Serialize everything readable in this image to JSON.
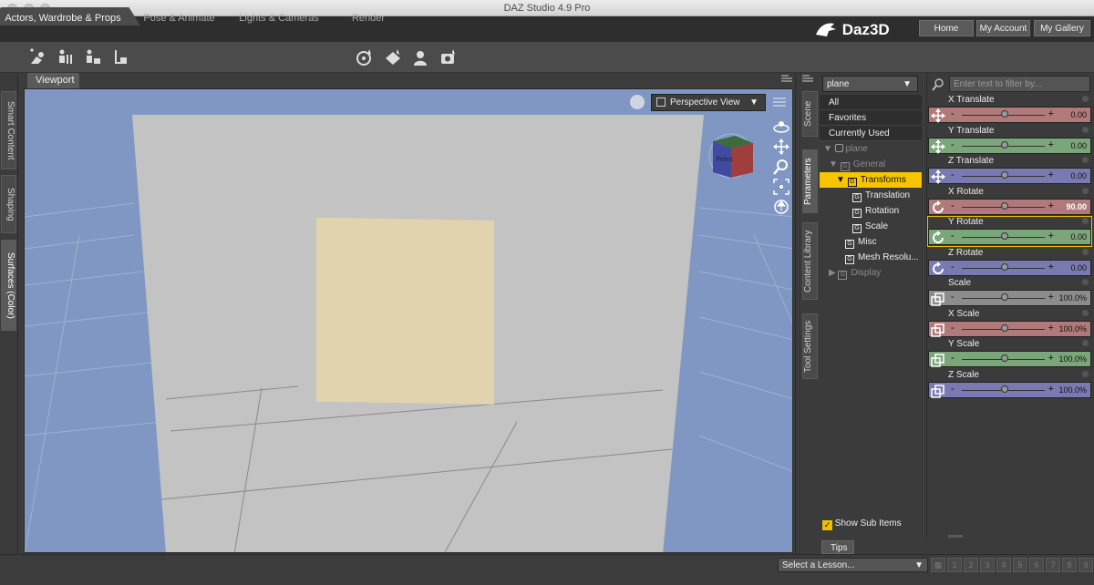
{
  "window": {
    "title": "DAZ Studio 4.9 Pro"
  },
  "tabs": [
    "Actors, Wardrobe & Props",
    "Pose & Animate",
    "Lights & Cameras",
    "Render"
  ],
  "brand": {
    "logo_text": "Daz3D"
  },
  "top_buttons": [
    "Home",
    "My Account",
    "My Gallery"
  ],
  "left_tabs": [
    "Smart Content",
    "Shaping",
    "Surfaces (Color)"
  ],
  "viewport": {
    "tab_label": "Viewport",
    "view_mode": "Perspective View",
    "cube_label": "Front"
  },
  "right_tabs": [
    "Scene",
    "Parameters",
    "Content Library",
    "Tool Settings"
  ],
  "tree": {
    "node_selector": "plane",
    "filters": [
      "All",
      "Favorites",
      "Currently Used"
    ],
    "items": [
      {
        "label": "plane"
      },
      {
        "label": "General"
      },
      {
        "label": "Transforms"
      },
      {
        "label": "Translation"
      },
      {
        "label": "Rotation"
      },
      {
        "label": "Scale"
      },
      {
        "label": "Misc"
      },
      {
        "label": "Mesh Resolu..."
      },
      {
        "label": "Display"
      }
    ],
    "show_sub_items": "Show Sub Items"
  },
  "filter": {
    "placeholder": "Enter text to filter by..."
  },
  "colors": {
    "x_axis": "#b07a7a",
    "y_axis": "#7aa67a",
    "z_axis": "#7a7ab2",
    "neutral": "#8c8c8c",
    "selection": "#f7c500"
  },
  "sliders": [
    {
      "label": "X Translate",
      "value": "0.00",
      "level": 0.5
    },
    {
      "label": "Y Translate",
      "value": "0.00",
      "level": 0.5
    },
    {
      "label": "Z Translate",
      "value": "0.00",
      "level": 0.5
    },
    {
      "label": "X Rotate",
      "value": "90.00",
      "level": 0.5
    },
    {
      "label": "Y Rotate",
      "value": "0.00",
      "level": 0.5
    },
    {
      "label": "Z Rotate",
      "value": "0.00",
      "level": 0.5
    },
    {
      "label": "Scale",
      "value": "100.0%",
      "level": 0.5
    },
    {
      "label": "X Scale",
      "value": "100.0%",
      "level": 0.5
    },
    {
      "label": "Y Scale",
      "value": "100.0%",
      "level": 0.5
    },
    {
      "label": "Z Scale",
      "value": "100.0%",
      "level": 0.5
    }
  ],
  "bottom": {
    "tips_tab": "Tips",
    "lesson_select": "Select a Lesson...",
    "lesson_numbers": [
      "1",
      "2",
      "3",
      "4",
      "5",
      "6",
      "7",
      "8",
      "9"
    ]
  }
}
